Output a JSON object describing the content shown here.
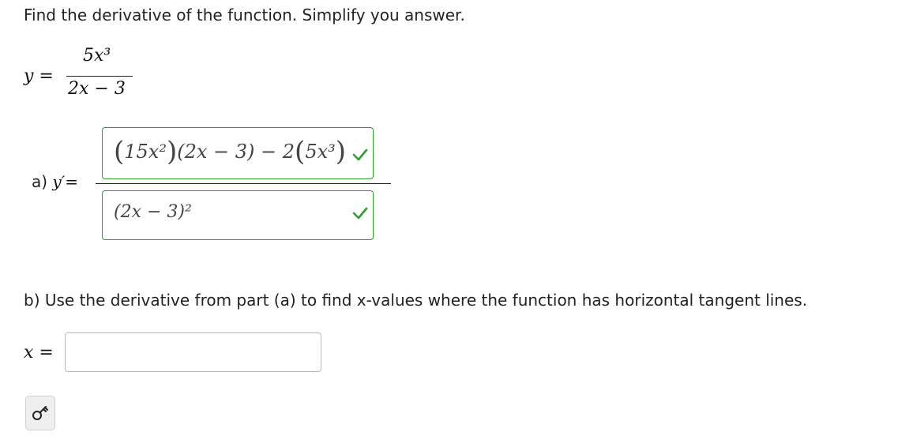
{
  "question": {
    "prompt": "Find the derivative of the function. Simplify you answer.",
    "function_lhs": "y =",
    "function_numerator": "5x³",
    "function_denominator": "2x − 3"
  },
  "part_a": {
    "label_prefix": "a) ",
    "label_math": "y′=",
    "numerator_answer": {
      "t1_open": "(",
      "t1": "15x²",
      "t1_close": ")",
      "t2": "(2x − 3) − 2",
      "t3_open": "(",
      "t3": "5x³",
      "t3_close": ")",
      "status": "correct"
    },
    "denominator_answer": {
      "text": "(2x − 3)²",
      "status": "correct"
    }
  },
  "part_b": {
    "prompt": "b) Use the derivative from part (a) to find x-values where the function has horizontal tangent lines.",
    "input_label": "x =",
    "input_value": "",
    "input_placeholder": ""
  },
  "toolbar": {
    "key_icon": "key-icon"
  },
  "colors": {
    "correct": "#2e9e2e",
    "text": "#222222"
  }
}
